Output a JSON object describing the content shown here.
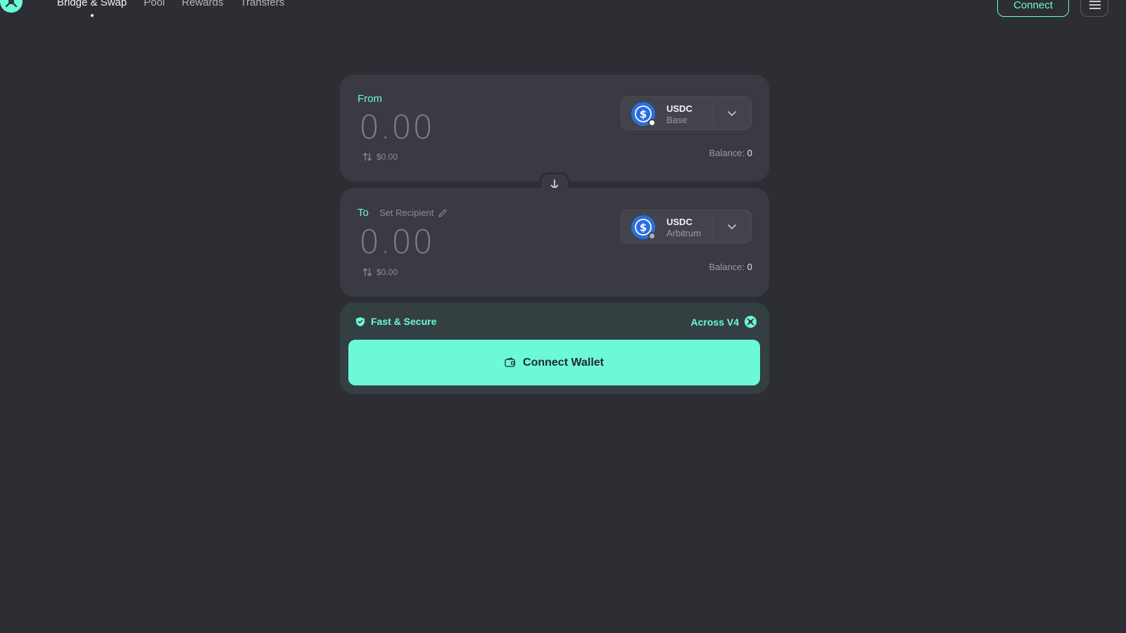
{
  "colors": {
    "accent": "#6cf9d8",
    "background": "#2d2e33",
    "panel": "#393a42",
    "usdc": "#2a6ee0"
  },
  "nav": {
    "items": [
      {
        "label": "Bridge & Swap",
        "active": true
      },
      {
        "label": "Pool"
      },
      {
        "label": "Rewards"
      },
      {
        "label": "Transfers"
      }
    ]
  },
  "header": {
    "connect_label": "Connect",
    "menu_icon": "hamburger-icon",
    "logo_icon": "across-logo-icon"
  },
  "from": {
    "label": "From",
    "amount": "0.00",
    "usd_value": "$0.00",
    "token": {
      "symbol": "USDC",
      "chain": "Base"
    },
    "balance_label": "Balance:",
    "balance_value": "0"
  },
  "to": {
    "label": "To",
    "recipient_label": "Set Recipient",
    "amount": "0.00",
    "usd_value": "$0.00",
    "token": {
      "symbol": "USDC",
      "chain": "Arbitrum"
    },
    "balance_label": "Balance:",
    "balance_value": "0"
  },
  "footer": {
    "security_label": "Fast & Secure",
    "provider_label": "Across V4",
    "connect_wallet_label": "Connect Wallet"
  }
}
